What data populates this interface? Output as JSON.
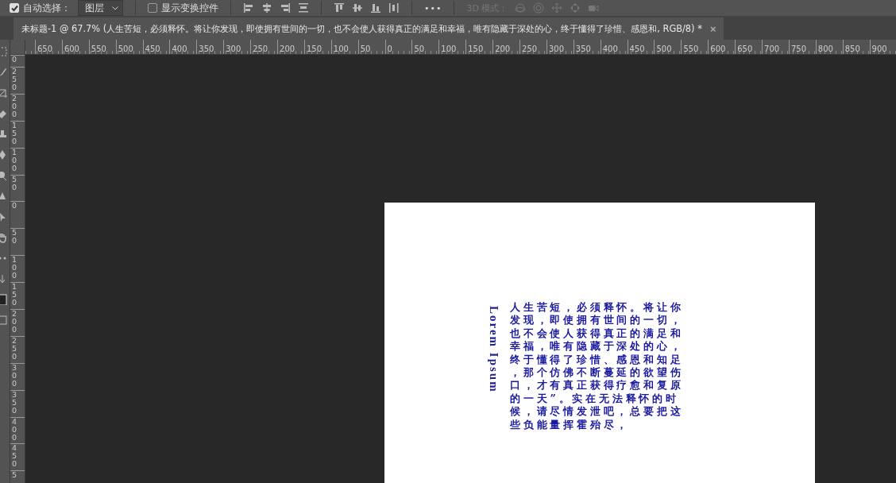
{
  "options_bar": {
    "auto_select": {
      "label": "自动选择：",
      "checked": true
    },
    "target_dropdown": {
      "value": "图层"
    },
    "transform_controls": {
      "label": "显示变换控件",
      "checked": false
    },
    "more_button": "•••",
    "mode_3d": {
      "label": "3D 模式：",
      "disabled": true
    }
  },
  "document_tab": {
    "title": "未标题-1 @ 67.7% (人生苦短，必须释怀。将让你发现，即使拥有世间的一切，也不会使人获得真正的满足和幸福，唯有隐藏于深处的心，终于懂得了珍惜、感恩和, RGB/8) *",
    "close": "×",
    "selected": true
  },
  "horizontal_ruler": [
    "650",
    "600",
    "550",
    "500",
    "450",
    "400",
    "350",
    "300",
    "250",
    "200",
    "150",
    "100",
    "50",
    "0",
    "50",
    "100",
    "150",
    "200",
    "250",
    "300",
    "350",
    "400",
    "450",
    "500",
    "550",
    "600",
    "650",
    "700",
    "750",
    "800",
    "850",
    "900"
  ],
  "vertical_ruler": [
    "0",
    "250",
    "200",
    "150",
    "100",
    "50",
    "0",
    "50",
    "100",
    "150",
    "200",
    "250",
    "300",
    "350",
    "400",
    "450",
    "5"
  ],
  "document": {
    "vertical_title": "Lorem Ipsum",
    "paragraph": "人生苦短，必须释怀。将让你发现，即使拥有世间的一切，也不会使人获得真正的满足和幸福，唯有隐藏于深处的心，终于懂得了珍惜、感恩和知足，那个仿佛不断蔓延的欲望伤口，才有真正获得疗愈和复原的一天”。实在无法释怀的时候，请尽情发泄吧，总要把这些负能量挥霍殆尽，"
  }
}
